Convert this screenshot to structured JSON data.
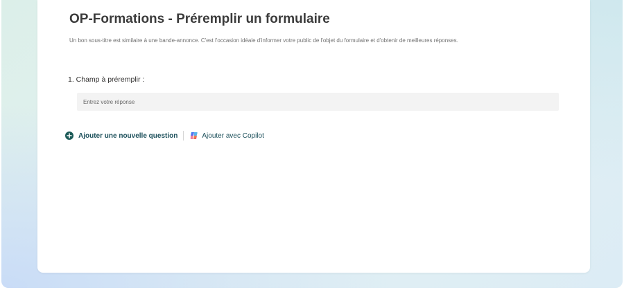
{
  "form": {
    "title": "OP-Formations - Préremplir un formulaire",
    "subtitle": "Un bon sous-titre est similaire à une bande-annonce. C'est l'occasion idéale d'informer votre public de l'objet du formulaire et d'obtenir de meilleures réponses."
  },
  "questions": [
    {
      "label": "1. Champ à préremplir :",
      "answer_placeholder": "Entrez votre réponse"
    }
  ],
  "actions": {
    "add_question_label": "Ajouter une nouvelle question",
    "add_copilot_label": "Ajouter avec Copilot"
  },
  "icons": {
    "add": "plus-circle-icon",
    "copilot": "copilot-icon"
  },
  "colors": {
    "accent": "#1b5a57",
    "action_text": "#1b4f5a"
  }
}
